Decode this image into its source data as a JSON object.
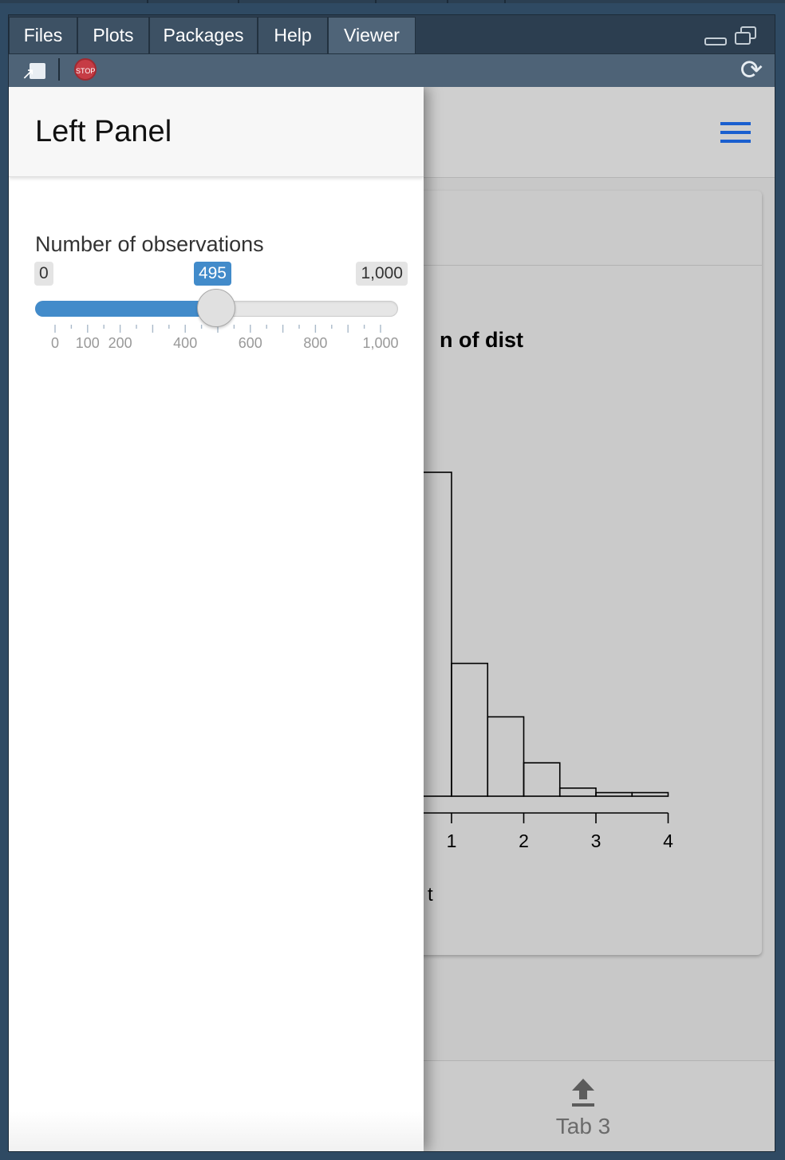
{
  "tabs": [
    {
      "label": "Files",
      "active": false
    },
    {
      "label": "Plots",
      "active": false
    },
    {
      "label": "Packages",
      "active": false
    },
    {
      "label": "Help",
      "active": false
    },
    {
      "label": "Viewer",
      "active": true
    }
  ],
  "toolbar": {
    "stop_label": "STOP",
    "export_icon": "export-icon",
    "stop_icon": "stop-icon",
    "refresh_icon": "refresh-icon"
  },
  "panel": {
    "title": "Left Panel",
    "slider": {
      "label": "Number of observations",
      "min_label": "0",
      "max_label": "1,000",
      "value_label": "495",
      "min": 0,
      "max": 1000,
      "value": 495,
      "tick_labels": [
        {
          "value": 0,
          "label": "0"
        },
        {
          "value": 100,
          "label": "100"
        },
        {
          "value": 200,
          "label": "200"
        },
        {
          "value": 400,
          "label": "400"
        },
        {
          "value": 600,
          "label": "600"
        },
        {
          "value": 800,
          "label": "800"
        },
        {
          "value": 1000,
          "label": "1,000"
        }
      ]
    }
  },
  "chart_data": {
    "type": "bar",
    "title": "n of dist",
    "xlabel": "t",
    "x_ticks": [
      1,
      2,
      3,
      4
    ],
    "bins": [
      {
        "x0": 0.5,
        "x1": 1.0,
        "height": 1000
      },
      {
        "x0": 1.0,
        "x1": 1.5,
        "height": 410
      },
      {
        "x0": 1.5,
        "x1": 2.0,
        "height": 245
      },
      {
        "x0": 2.0,
        "x1": 2.5,
        "height": 103
      },
      {
        "x0": 2.5,
        "x1": 3.0,
        "height": 25
      },
      {
        "x0": 3.0,
        "x1": 3.5,
        "height": 11
      },
      {
        "x0": 3.5,
        "x1": 4.0,
        "height": 11
      }
    ]
  },
  "footer": {
    "tab3_label": "Tab 3",
    "tab3_icon": "upload-icon"
  },
  "menu_icon": "hamburger-menu-icon"
}
